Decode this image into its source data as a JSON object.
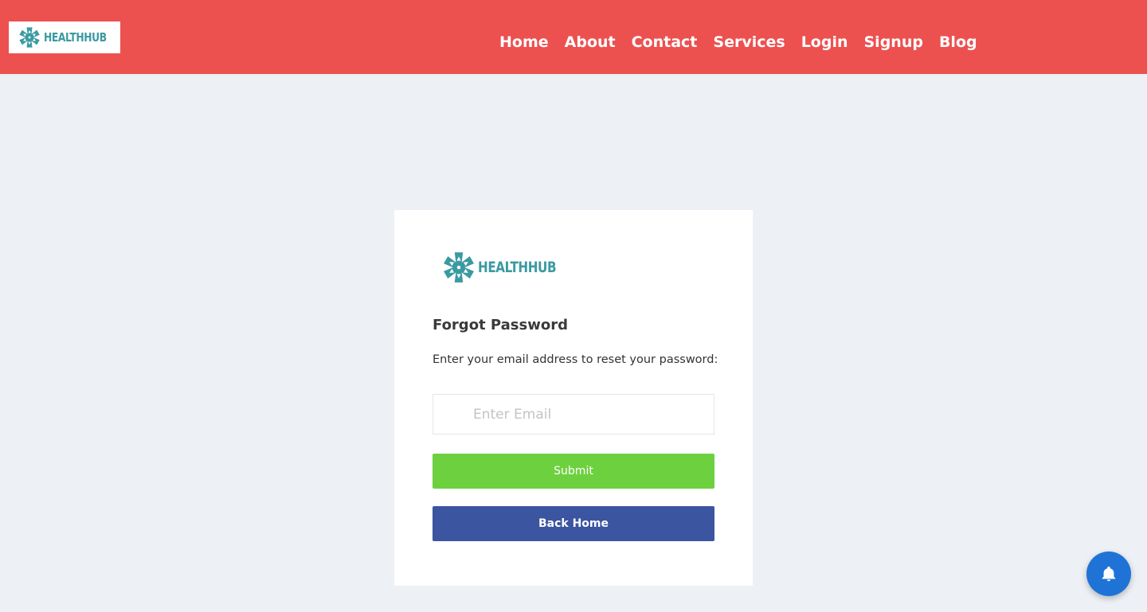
{
  "header": {
    "brand": "HEALTHHUB",
    "nav": [
      {
        "label": "Home"
      },
      {
        "label": "About"
      },
      {
        "label": "Contact"
      },
      {
        "label": "Services"
      },
      {
        "label": "Login"
      },
      {
        "label": "Signup"
      },
      {
        "label": "Blog"
      }
    ]
  },
  "card": {
    "brand": "HEALTHHUB",
    "title": "Forgot Password",
    "description": "Enter your email address to reset your password:",
    "email": {
      "value": "",
      "placeholder": "Enter Email"
    },
    "submit_label": "Submit",
    "back_label": "Back Home"
  },
  "notification": {
    "icon": "bell-icon"
  },
  "colors": {
    "header_bg": "#ec5150",
    "page_bg": "#edf0f4",
    "brand_teal": "#3a9aa2",
    "submit_green": "#6dd13f",
    "back_blue": "#3b55a0",
    "fab_blue": "#1f73d6"
  }
}
